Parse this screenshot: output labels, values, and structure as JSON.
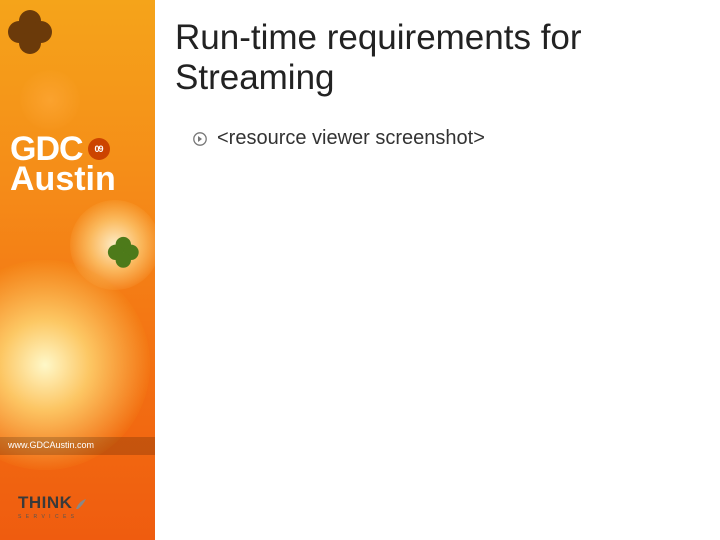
{
  "sidebar": {
    "logo_gdc": "GDC",
    "badge_year": "09",
    "logo_city": "Austin",
    "url": "www.GDCAustin.com",
    "sponsor_main": "THINK",
    "sponsor_sub": "S E R V I C E S"
  },
  "slide": {
    "title": "Run-time requirements for Streaming",
    "bullets": [
      "<resource viewer screenshot>"
    ]
  }
}
